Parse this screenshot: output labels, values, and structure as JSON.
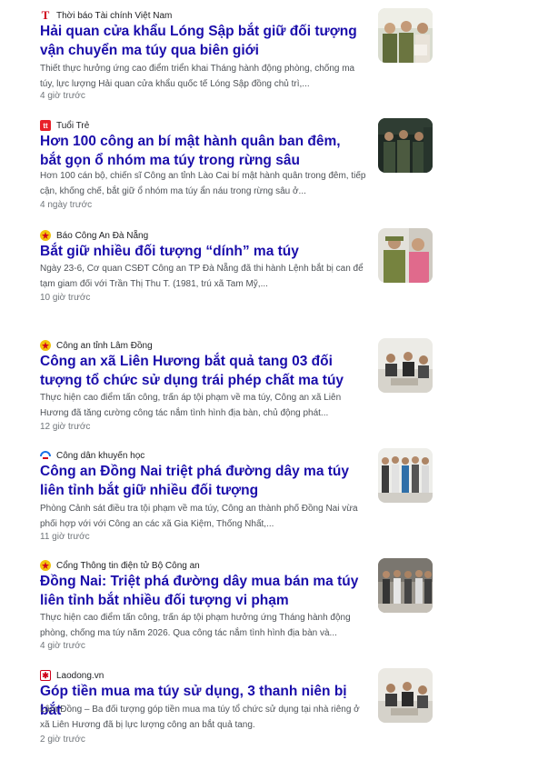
{
  "articles": [
    {
      "source": "Thời báo Tài chính Việt Nam",
      "source_icon": "letter-t-red-icon",
      "title": "Hải quan cửa khẩu Lóng Sập bắt giữ đối tượng vận chuyển ma túy qua biên giới",
      "snippet": "Thiết thực hưởng ứng cao điểm triển khai Tháng hành động phòng, chống ma túy, lực lượng Hải quan cửa khẩu quốc tế Lóng Sập đồng chủ trì,...",
      "time": "4 giờ trước"
    },
    {
      "source": "Tuổi Trẻ",
      "source_icon": "tuoi-tre-logo-icon",
      "title": "Hơn 100 công an bí mật hành quân ban đêm, bắt gọn ổ nhóm ma túy trong rừng sâu",
      "snippet": "Hơn 100 cán bộ, chiến sĩ Công an tỉnh Lào Cai bí mật hành quân trong đêm, tiếp cận, khống chế, bắt giữ ổ nhóm ma túy ẩn náu trong rừng sâu ở...",
      "time": "4 ngày trước"
    },
    {
      "source": "Báo Công An Đà Nẵng",
      "source_icon": "police-emblem-icon",
      "title": "Bắt giữ nhiều đối tượng “dính” ma túy",
      "snippet": "Ngày 23-6, Cơ quan CSĐT Công an TP Đà Nẵng đã thi hành Lệnh bắt bị can để tạm giam đối với Trần Thị Thu T. (1981, trú xã Tam Mỹ,...",
      "time": "10 giờ trước"
    },
    {
      "source": "Công an tỉnh Lâm Đồng",
      "source_icon": "police-emblem-icon",
      "title": "Công an xã Liên Hương bắt quả tang 03 đối tượng tổ chức sử dụng trái phép chất ma túy",
      "snippet": "Thực hiện cao điểm tấn công, trấn áp tội phạm về ma túy, Công an xã Liên Hương đã tăng cường công tác nắm tình hình địa bàn, chủ động phát...",
      "time": "12 giờ trước"
    },
    {
      "source": "Công dân khuyến học",
      "source_icon": "cdkh-logo-icon",
      "title": "Công an Đồng Nai triệt phá đường dây ma túy liên tỉnh bắt giữ nhiều đối tượng",
      "snippet": "Phòng Cảnh sát điều tra tội phạm về ma túy, Công an thành phố Đồng Nai vừa phối hợp với với Công an các xã Gia Kiệm, Thống Nhất,...",
      "time": "11 giờ trước"
    },
    {
      "source": "Cổng Thông tin điện tử Bộ Công an",
      "source_icon": "police-emblem-icon",
      "title": "Đồng Nai: Triệt phá đường dây mua bán ma túy liên tỉnh bắt nhiều đối tượng vi phạm",
      "snippet": "Thực hiện cao điểm tấn công, trấn áp tội phạm hưởng ứng Tháng hành động phòng, chống ma túy năm 2026. Qua công tác nắm tình hình địa bàn và...",
      "time": "4 giờ trước"
    },
    {
      "source": "Laodong.vn",
      "source_icon": "laodong-logo-icon",
      "title": "Góp tiền mua ma túy sử dụng, 3 thanh niên bị bắt",
      "snippet": "Lâm Đồng – Ba đối tượng góp tiền mua ma túy tổ chức sử dụng tại nhà riêng ở xã Liên Hương đã bị lực lượng công an bắt quả tang.",
      "time": "2 giờ trước"
    }
  ]
}
